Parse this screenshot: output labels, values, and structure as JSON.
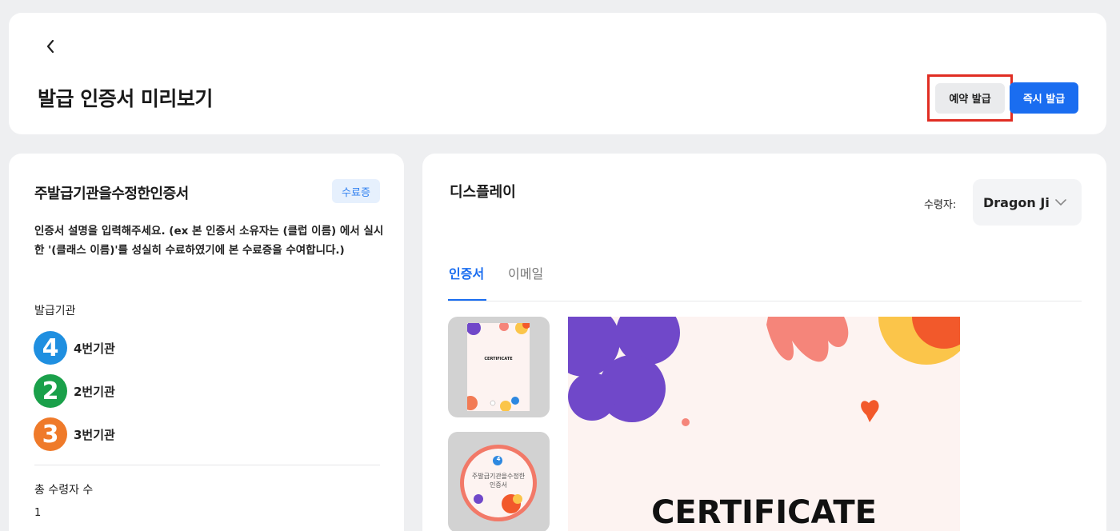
{
  "header": {
    "title": "발급 인증서 미리보기",
    "reserve_button": "예약 발급",
    "issue_button": "즉시 발급"
  },
  "left_panel": {
    "cert_name": "주발급기관을수정한인증서",
    "status_badge": "수료증",
    "description": "인증서 설명을 입력해주세요. (ex 본 인증서 소유자는 (클럽 이름) 에서 실시한 '(클래스 이름)'를 성실히 수료하였기에 본 수료증을 수여합니다.)",
    "issuer_label": "발급기관",
    "issuers": [
      {
        "number": "4",
        "name": "4번기관",
        "color": "#1f8fe0"
      },
      {
        "number": "2",
        "name": "2번기관",
        "color": "#1aa04a"
      },
      {
        "number": "3",
        "name": "3번기관",
        "color": "#ef7a2a"
      }
    ],
    "recipients_label": "총 수령자 수",
    "recipients_count": "1"
  },
  "right_panel": {
    "title": "디스플레이",
    "recipient_label": "수령자:",
    "recipient_name": "Dragon Ji",
    "tabs": [
      {
        "label": "인증서",
        "active": true
      },
      {
        "label": "이메일",
        "active": false
      }
    ],
    "preview_title": "CERTIFICATE",
    "thumb1_title": "CERTIFICATE",
    "thumb2_badge": "4",
    "thumb2_text": "주발급기관을수정한인증서"
  },
  "colors": {
    "accent": "#1a6df0",
    "highlight_border": "#e02d23",
    "badge_bg": "#e6f0fd",
    "badge_text": "#2e7ff0"
  }
}
